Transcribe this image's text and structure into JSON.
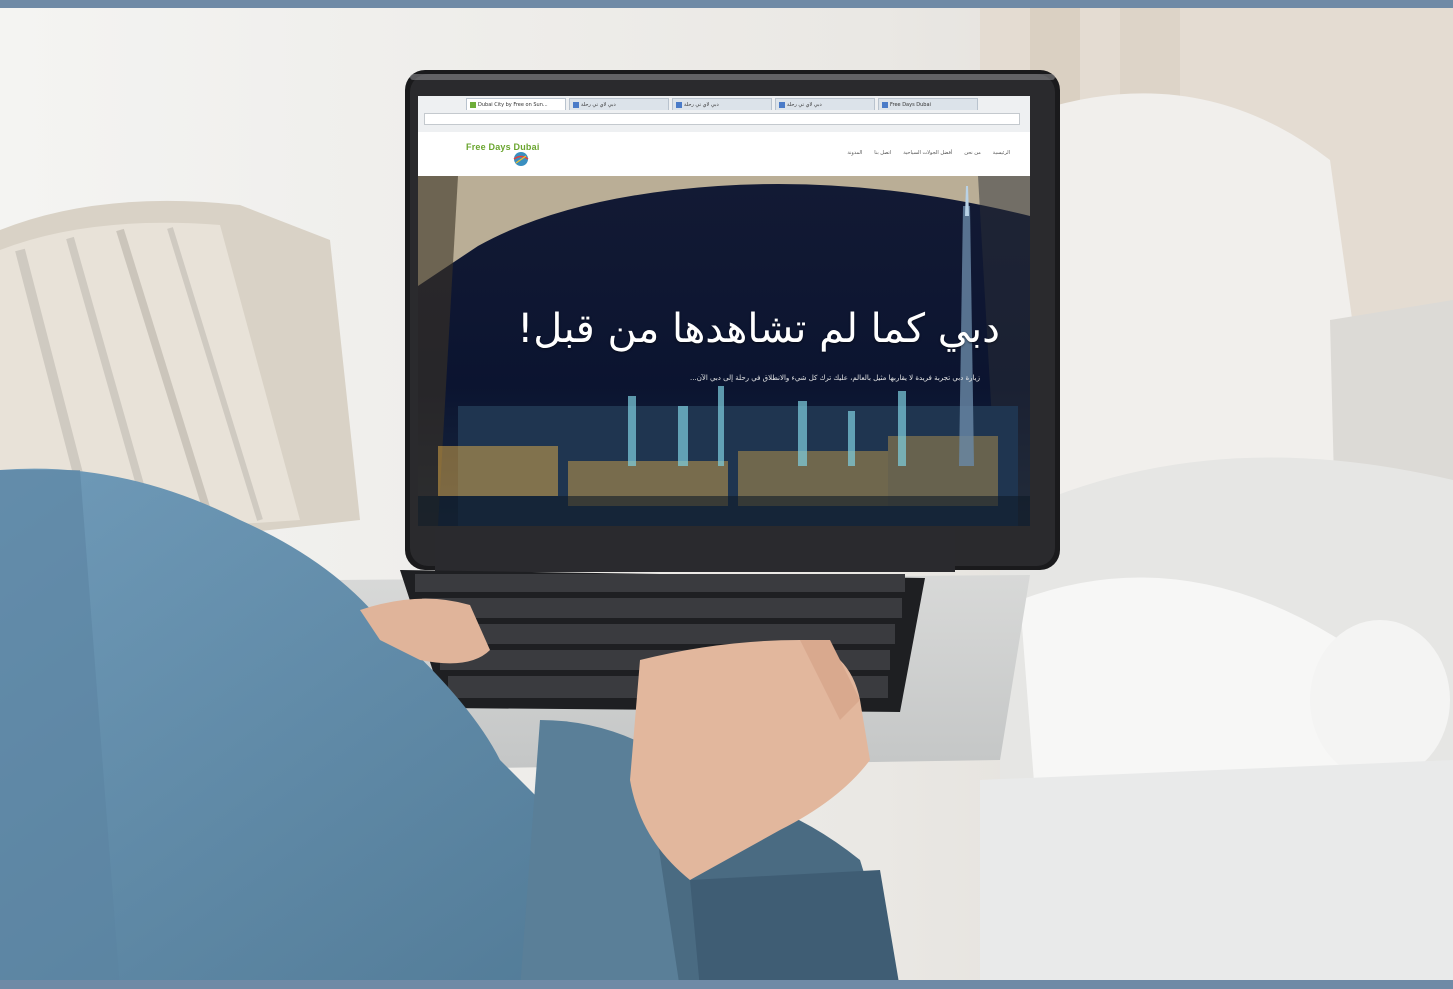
{
  "browser": {
    "tabs": [
      {
        "label": "Dubai City by Free on Sun...",
        "active": true
      },
      {
        "label": "دبي لاي تي رحلة",
        "active": false
      },
      {
        "label": "دبي لاي تي رحلة",
        "active": false
      },
      {
        "label": "دبي لاي تي رحلة",
        "active": false
      },
      {
        "label": "Free Days Dubai",
        "active": false
      }
    ],
    "address": ""
  },
  "site": {
    "logo_text": "Free Days Dubai",
    "nav": [
      "الرئيسية",
      "من نحن",
      "أفضل الجولات السياحية",
      "اتصل بنا",
      "المدونة"
    ]
  },
  "hero": {
    "title": "دبي كما لم تشاهدها من قبل!",
    "subtitle": "زيارة دبي تجربة فريدة لا يقاربها مثيل بالعالم، عليك ترك كل شيء والانطلاق في رحلة إلى دبي الآن..."
  },
  "colors": {
    "frame": "#6f8aa6",
    "logo_green": "#6aa52f",
    "hero_text": "#ffffff"
  }
}
